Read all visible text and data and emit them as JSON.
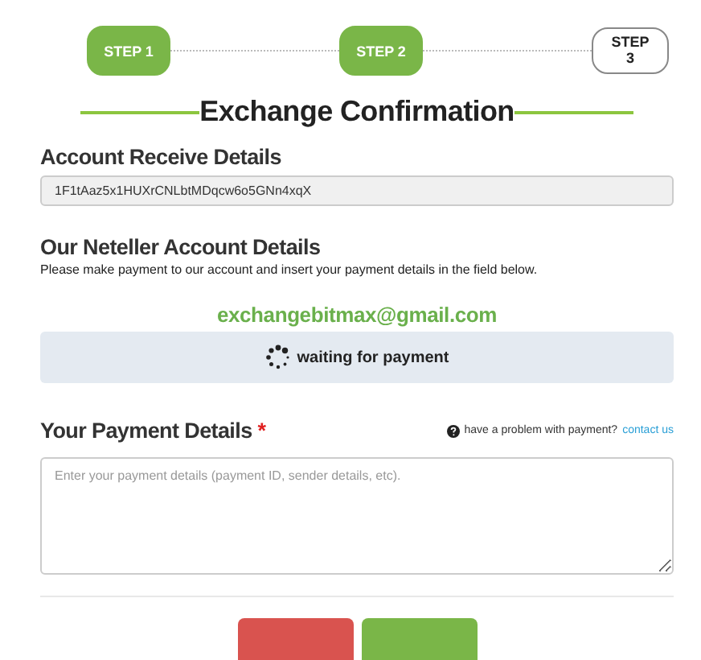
{
  "steps": [
    {
      "label": "STEP 1",
      "complete": true
    },
    {
      "label": "STEP 2",
      "complete": true
    },
    {
      "label": "STEP 3",
      "complete": false
    }
  ],
  "title": "Exchange Confirmation",
  "account_receive": {
    "heading": "Account Receive Details",
    "value": "1F1tAaz5x1HUXrCNLbtMDqcw6o5GNn4xqX"
  },
  "neteller": {
    "heading": "Our Neteller Account Details",
    "instructions": "Please make payment to our account and insert your payment details in the field below.",
    "email": "exchangebitmax@gmail.com",
    "status": "waiting for payment"
  },
  "payment": {
    "heading": "Your Payment Details",
    "required_mark": "*",
    "help_text": "have a problem with payment?",
    "help_link": "contact us",
    "placeholder": "Enter your payment details (payment ID, sender details, etc)."
  },
  "buttons": [
    {
      "color": "#d9534f"
    },
    {
      "color": "#7ab648"
    }
  ]
}
